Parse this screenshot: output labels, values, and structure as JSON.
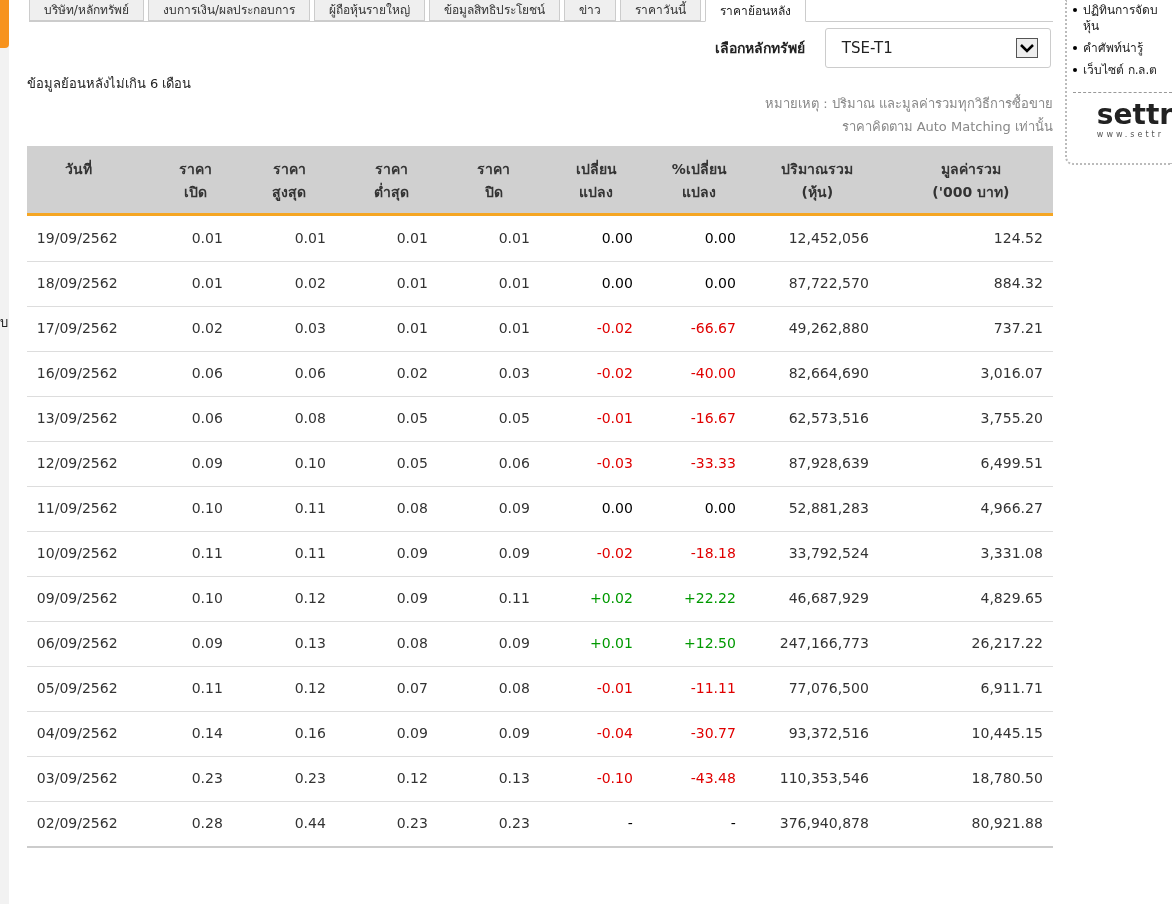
{
  "sidebar": {
    "items": [
      {
        "label": "บ"
      }
    ]
  },
  "tabs": [
    {
      "label": "บริษัท/หลักทรัพย์",
      "selected": false
    },
    {
      "label": "งบการเงิน/ผลประกอบการ",
      "selected": false
    },
    {
      "label": "ผู้ถือหุ้นรายใหญ่",
      "selected": false
    },
    {
      "label": "ข้อมูลสิทธิประโยชน์",
      "selected": false
    },
    {
      "label": "ข่าว",
      "selected": false
    },
    {
      "label": "ราคาวันนี้",
      "selected": false
    },
    {
      "label": "ราคาย้อนหลัง",
      "selected": true
    }
  ],
  "security_select": {
    "label": "เลือกหลักทรัพย์",
    "value": "TSE-T1"
  },
  "period_note": "ข้อมูลย้อนหลังไม่เกิน 6 เดือน",
  "remarks": [
    "หมายเหตุ : ปริมาณ และมูลค่ารวมทุกวิธีการซื้อขาย",
    "ราคาคิดตาม Auto Matching เท่านั้น"
  ],
  "table": {
    "columns": [
      "วันที่",
      "ราคา\nเปิด",
      "ราคา\nสูงสุด",
      "ราคา\nต่ำสุด",
      "ราคา\nปิด",
      "เปลี่ยน\nแปลง",
      "%เปลี่ยน\nแปลง",
      "ปริมาณรวม\n(หุ้น)",
      "มูลค่ารวม\n('000 บาท)"
    ],
    "rows": [
      {
        "color": "#000000",
        "cells": [
          "19/09/2562",
          "0.01",
          "0.01",
          "0.01",
          "0.01",
          "0.00",
          "0.00",
          "12,452,056",
          "124.52"
        ]
      },
      {
        "color": "#000000",
        "cells": [
          "18/09/2562",
          "0.01",
          "0.02",
          "0.01",
          "0.01",
          "0.00",
          "0.00",
          "87,722,570",
          "884.32"
        ]
      },
      {
        "color": "#e00000",
        "cells": [
          "17/09/2562",
          "0.02",
          "0.03",
          "0.01",
          "0.01",
          "-0.02",
          "-66.67",
          "49,262,880",
          "737.21"
        ]
      },
      {
        "color": "#e00000",
        "cells": [
          "16/09/2562",
          "0.06",
          "0.06",
          "0.02",
          "0.03",
          "-0.02",
          "-40.00",
          "82,664,690",
          "3,016.07"
        ]
      },
      {
        "color": "#e00000",
        "cells": [
          "13/09/2562",
          "0.06",
          "0.08",
          "0.05",
          "0.05",
          "-0.01",
          "-16.67",
          "62,573,516",
          "3,755.20"
        ]
      },
      {
        "color": "#e00000",
        "cells": [
          "12/09/2562",
          "0.09",
          "0.10",
          "0.05",
          "0.06",
          "-0.03",
          "-33.33",
          "87,928,639",
          "6,499.51"
        ]
      },
      {
        "color": "#000000",
        "cells": [
          "11/09/2562",
          "0.10",
          "0.11",
          "0.08",
          "0.09",
          "0.00",
          "0.00",
          "52,881,283",
          "4,966.27"
        ]
      },
      {
        "color": "#e00000",
        "cells": [
          "10/09/2562",
          "0.11",
          "0.11",
          "0.09",
          "0.09",
          "-0.02",
          "-18.18",
          "33,792,524",
          "3,331.08"
        ]
      },
      {
        "color": "#009900",
        "cells": [
          "09/09/2562",
          "0.10",
          "0.12",
          "0.09",
          "0.11",
          "+0.02",
          "+22.22",
          "46,687,929",
          "4,829.65"
        ]
      },
      {
        "color": "#009900",
        "cells": [
          "06/09/2562",
          "0.09",
          "0.13",
          "0.08",
          "0.09",
          "+0.01",
          "+12.50",
          "247,166,773",
          "26,217.22"
        ]
      },
      {
        "color": "#e00000",
        "cells": [
          "05/09/2562",
          "0.11",
          "0.12",
          "0.07",
          "0.08",
          "-0.01",
          "-11.11",
          "77,076,500",
          "6,911.71"
        ]
      },
      {
        "color": "#e00000",
        "cells": [
          "04/09/2562",
          "0.14",
          "0.16",
          "0.09",
          "0.09",
          "-0.04",
          "-30.77",
          "93,372,516",
          "10,445.15"
        ]
      },
      {
        "color": "#e00000",
        "cells": [
          "03/09/2562",
          "0.23",
          "0.23",
          "0.12",
          "0.13",
          "-0.10",
          "-43.48",
          "110,353,546",
          "18,780.50"
        ]
      },
      {
        "color": "#000000",
        "cells": [
          "02/09/2562",
          "0.28",
          "0.44",
          "0.23",
          "0.23",
          "-",
          "-",
          "376,940,878",
          "80,921.88"
        ]
      }
    ]
  },
  "side_links": [
    {
      "label": "ปฏิทินการจัดบ",
      "sub": "หุ้น"
    },
    {
      "label": "คำศัพท์น่ารู้"
    },
    {
      "label": "เว็บไซต์ ก.ล.ต"
    }
  ],
  "logo": {
    "name": "settr",
    "url": "www.settr"
  }
}
